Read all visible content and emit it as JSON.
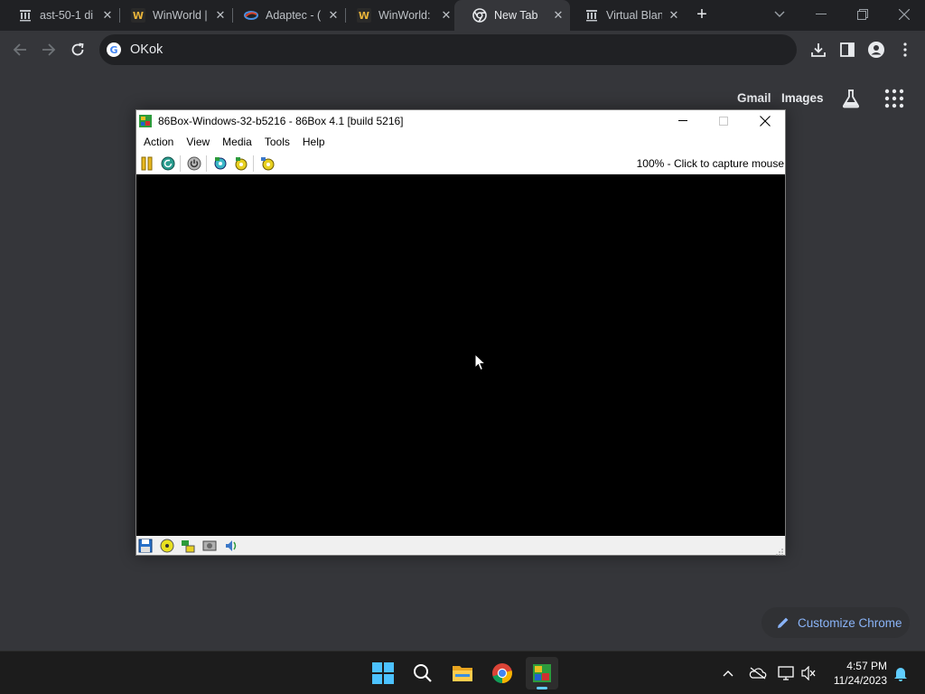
{
  "browser": {
    "tabs": [
      {
        "title": "ast-50-1 di",
        "icon": "archive-icon",
        "active": false
      },
      {
        "title": "WinWorld |",
        "icon": "winworld-icon",
        "active": false
      },
      {
        "title": "Adaptec - (",
        "icon": "adaptec-icon",
        "active": false
      },
      {
        "title": "WinWorld:",
        "icon": "winworld-icon",
        "active": false
      },
      {
        "title": "New Tab",
        "icon": "chrome-icon",
        "active": true
      },
      {
        "title": "Virtual Blan",
        "icon": "archive-icon",
        "active": false
      }
    ],
    "omnibox": {
      "value": "OKok",
      "icon": "google-icon"
    },
    "ntp": {
      "gmail_label": "Gmail",
      "images_label": "Images",
      "customize_label": "Customize Chrome"
    },
    "colors": {
      "frame": "#202124",
      "surface": "#35363a",
      "accent": "#8ab4f8"
    }
  },
  "vm_window": {
    "title": "86Box-Windows-32-b5216 - 86Box 4.1 [build 5216]",
    "menus": [
      "Action",
      "View",
      "Media",
      "Tools",
      "Help"
    ],
    "status": "100% - Click to capture mouse",
    "toolbar_icons": [
      "pause-icon",
      "reset-icon",
      "power-icon",
      "settings-icon",
      "ctrl-alt-del-icon",
      "hard-reset-icon"
    ],
    "statusbar_icons": [
      "floppy-icon",
      "cdrom-icon",
      "network-icon",
      "hdd-icon",
      "sound-icon"
    ]
  },
  "taskbar": {
    "apps": [
      "start-icon",
      "search-icon",
      "file-explorer-icon",
      "chrome-icon",
      "86box-icon"
    ],
    "tray_icons": [
      "chevron-up-icon",
      "onedrive-icon",
      "display-icon",
      "volume-muted-icon",
      "notification-bell-icon"
    ],
    "time": "4:57 PM",
    "date": "11/24/2023"
  }
}
